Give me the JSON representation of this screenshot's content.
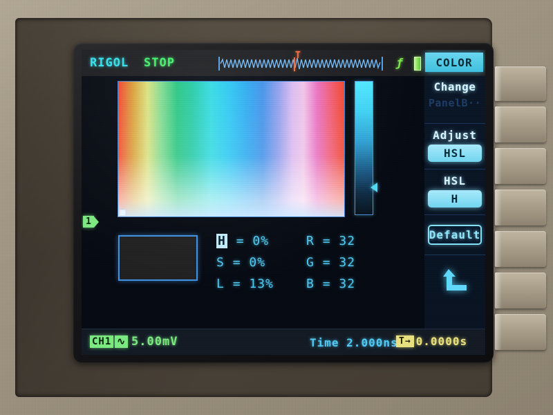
{
  "device": {
    "vendor_text": "RIGOL",
    "run_state": "STOP"
  },
  "screen": {
    "top_bar": {
      "brand": "RIGOL",
      "run_state": "STOP",
      "trigger_marker": "T",
      "trigger_coupling_icon": "f-trigger-icon",
      "level_indicator_icon": "level-bar-icon",
      "active_menu_tab": "COLOR"
    },
    "color_menu": {
      "change_label": "Change",
      "change_value": "PanelB··",
      "adjust_label": "Adjust",
      "adjust_value": "HSL",
      "component_label": "HSL",
      "component_value": "H",
      "default_label": "Default",
      "return_icon": "return-arrow-icon"
    },
    "color_picker": {
      "field_name": "hue-saturation-field",
      "luminance_slider_name": "luminance-slider",
      "luminance_pointer_percent": 83,
      "preview_swatch_color": "#202020",
      "readouts": [
        {
          "key": "H",
          "value": "0%",
          "selected": true,
          "key2": "R",
          "value2": "32"
        },
        {
          "key": "S",
          "value": "0%",
          "selected": false,
          "key2": "G",
          "value2": "32"
        },
        {
          "key": "L",
          "value": "13%",
          "selected": false,
          "key2": "B",
          "value2": "32"
        }
      ]
    },
    "bottom_bar": {
      "channel_label": "CH1",
      "channel_volts": "5.00mV",
      "timebase_label": "Time",
      "timebase_value": "2.000ns",
      "trigger_glyph": "T→",
      "trigger_position": "0.0000s"
    },
    "channel_marker": {
      "label": "1"
    }
  },
  "colors": {
    "accent_cyan": "#4fc8f2",
    "brand_cyan": "#31e0e8",
    "run_green": "#3ff06a",
    "channel_green": "#79e87e",
    "trigger_orange": "#f2683a",
    "trigger_yellow": "#e8e07a",
    "menu_highlight": "#6fd5ef",
    "bezel_tan": "#a89d89"
  }
}
